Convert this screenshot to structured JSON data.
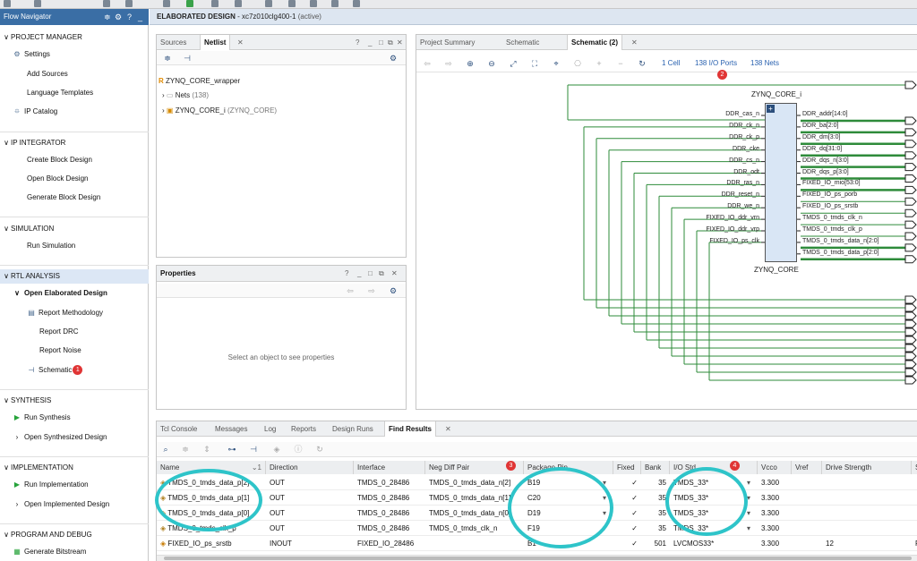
{
  "flow_navigator": {
    "title": "Flow Navigator",
    "controls": [
      "≑",
      "⚙",
      "?",
      "_"
    ],
    "sections": [
      {
        "label": "PROJECT MANAGER",
        "items": [
          "Settings",
          "Add Sources",
          "Language Templates",
          "IP Catalog"
        ]
      },
      {
        "label": "IP INTEGRATOR",
        "items": [
          "Create Block Design",
          "Open Block Design",
          "Generate Block Design"
        ]
      },
      {
        "label": "SIMULATION",
        "items": [
          "Run Simulation"
        ]
      },
      {
        "label": "RTL ANALYSIS",
        "items": [
          "Open Elaborated Design",
          "Report Methodology",
          "Report DRC",
          "Report Noise",
          "Schematic"
        ]
      },
      {
        "label": "SYNTHESIS",
        "items": [
          "Run Synthesis",
          "Open Synthesized Design"
        ]
      },
      {
        "label": "IMPLEMENTATION",
        "items": [
          "Run Implementation",
          "Open Implemented Design"
        ]
      },
      {
        "label": "PROGRAM AND DEBUG",
        "items": [
          "Generate Bitstream"
        ]
      }
    ],
    "schematic_badge": "1"
  },
  "title_bar": {
    "design": "ELABORATED DESIGN",
    "part": "- xc7z010clg400-1",
    "status": "(active)"
  },
  "sources_panel": {
    "tabs": [
      "Sources",
      "Netlist"
    ],
    "tree": {
      "root": "ZYNQ_CORE_wrapper",
      "nets": "Nets",
      "nets_count": "(138)",
      "cell": "ZYNQ_CORE_i",
      "cell_ref": "(ZYNQ_CORE)"
    }
  },
  "properties_panel": {
    "title": "Properties",
    "empty_text": "Select an object to see properties"
  },
  "schematic_panel": {
    "tabs": [
      "Project Summary",
      "Schematic",
      "Schematic (2)"
    ],
    "cells_link": "1 Cell",
    "ports_link": "138 I/O Ports",
    "nets_link": "138 Nets",
    "ports_badge": "2",
    "instance_name": "ZYNQ_CORE_i",
    "cell_name": "ZYNQ_CORE",
    "left_ports": [
      "DDR_cas_n",
      "DDR_ck_n",
      "DDR_ck_p",
      "DDR_cke",
      "DDR_cs_n",
      "DDR_odt",
      "DDR_ras_n",
      "DDR_reset_n",
      "DDR_we_n",
      "FIXED_IO_ddr_vrn",
      "FIXED_IO_ddr_vrp",
      "FIXED_IO_ps_clk"
    ],
    "right_ports": [
      "DDR_addr[14:0]",
      "DDR_ba[2:0]",
      "DDR_dm[3:0]",
      "DDR_dq[31:0]",
      "DDR_dqs_n[3:0]",
      "DDR_dqs_p[3:0]",
      "FIXED_IO_mio[53:0]",
      "FIXED_IO_ps_porb",
      "FIXED_IO_ps_srstb",
      "TMDS_0_tmds_clk_n",
      "TMDS_0_tmds_clk_p",
      "TMDS_0_tmds_data_n[2:0]",
      "TMDS_0_tmds_data_p[2:0]"
    ]
  },
  "bottom_panel": {
    "tabs": [
      "Tcl Console",
      "Messages",
      "Log",
      "Reports",
      "Design Runs",
      "Find Results"
    ],
    "columns": [
      "Name",
      "Direction",
      "Interface",
      "Neg Diff Pair",
      "Package Pin",
      "Fixed",
      "Bank",
      "I/O Std",
      "Vcco",
      "Vref",
      "Drive Strength",
      "S"
    ],
    "badge3": "3",
    "badge4": "4",
    "rows": [
      {
        "name": "TMDS_0_tmds_data_p[2]",
        "dir": "OUT",
        "iface": "TMDS_0_28486",
        "neg": "TMDS_0_tmds_data_n[2]",
        "pin": "B19",
        "fixed": "✓",
        "bank": "35",
        "iostd": "TMDS_33*",
        "vcco": "3.300",
        "vref": "",
        "drive": "",
        "s": ""
      },
      {
        "name": "TMDS_0_tmds_data_p[1]",
        "dir": "OUT",
        "iface": "TMDS_0_28486",
        "neg": "TMDS_0_tmds_data_n[1]",
        "pin": "C20",
        "fixed": "✓",
        "bank": "35",
        "iostd": "TMDS_33*",
        "vcco": "3.300",
        "vref": "",
        "drive": "",
        "s": ""
      },
      {
        "name": "TMDS_0_tmds_data_p[0]",
        "dir": "OUT",
        "iface": "TMDS_0_28486",
        "neg": "TMDS_0_tmds_data_n[0]",
        "pin": "D19",
        "fixed": "✓",
        "bank": "35",
        "iostd": "TMDS_33*",
        "vcco": "3.300",
        "vref": "",
        "drive": "",
        "s": ""
      },
      {
        "name": "TMDS_0_tmds_clk_p",
        "dir": "OUT",
        "iface": "TMDS_0_28486",
        "neg": "TMDS_0_tmds_clk_n",
        "pin": "F19",
        "fixed": "✓",
        "bank": "35",
        "iostd": "TMDS_33*",
        "vcco": "3.300",
        "vref": "",
        "drive": "",
        "s": ""
      },
      {
        "name": "FIXED_IO_ps_srstb",
        "dir": "INOUT",
        "iface": "FIXED_IO_28486",
        "neg": "",
        "pin": "B1",
        "fixed": "✓",
        "bank": "501",
        "iostd": "LVCMOS33*",
        "vcco": "3.300",
        "vref": "",
        "drive": "12",
        "s": "F"
      }
    ]
  }
}
